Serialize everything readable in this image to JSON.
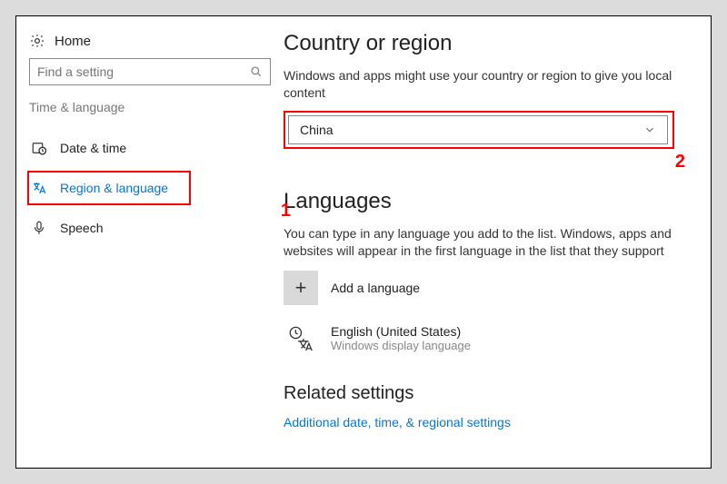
{
  "sidebar": {
    "home": "Home",
    "search_placeholder": "Find a setting",
    "category": "Time & language",
    "items": [
      {
        "label": "Date & time"
      },
      {
        "label": "Region & language"
      },
      {
        "label": "Speech"
      }
    ]
  },
  "annotations": {
    "callout1": "1",
    "callout2": "2"
  },
  "main": {
    "region": {
      "heading": "Country or region",
      "desc": "Windows and apps might use your country or region to give you local content",
      "selected": "China"
    },
    "languages": {
      "heading": "Languages",
      "desc": "You can type in any language you add to the list. Windows, apps and websites will appear in the first language in the list that they support",
      "add_label": "Add a language",
      "installed": [
        {
          "name": "English (United States)",
          "subtitle": "Windows display language"
        }
      ]
    },
    "related": {
      "heading": "Related settings",
      "link": "Additional date, time, & regional settings"
    }
  }
}
